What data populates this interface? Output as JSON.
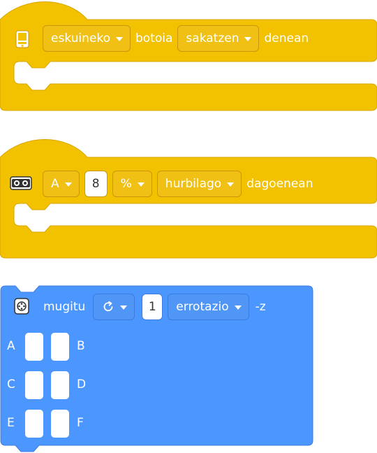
{
  "blocks": {
    "button_event": {
      "hand_option": "eskuineko",
      "text_button": "botoia",
      "press_option": "sakatzen",
      "text_when": "denean",
      "icon": "hub-button-icon",
      "color": "#f2c200"
    },
    "distance_event": {
      "port_option": "A",
      "value": "8",
      "unit_option": "%",
      "compare_option": "hurbilago",
      "text_when": "dagoenean",
      "icon": "distance-sensor-icon",
      "color": "#f2c200"
    },
    "move_block": {
      "text_move": "mugitu",
      "direction_icon": "rotate-clockwise-icon",
      "value": "1",
      "unit_option": "errotazio",
      "suffix": "-z",
      "icon": "motor-icon",
      "color": "#4c97ff",
      "ports": {
        "a": "A",
        "b": "B",
        "c": "C",
        "d": "D",
        "e": "E",
        "f": "F"
      }
    }
  }
}
